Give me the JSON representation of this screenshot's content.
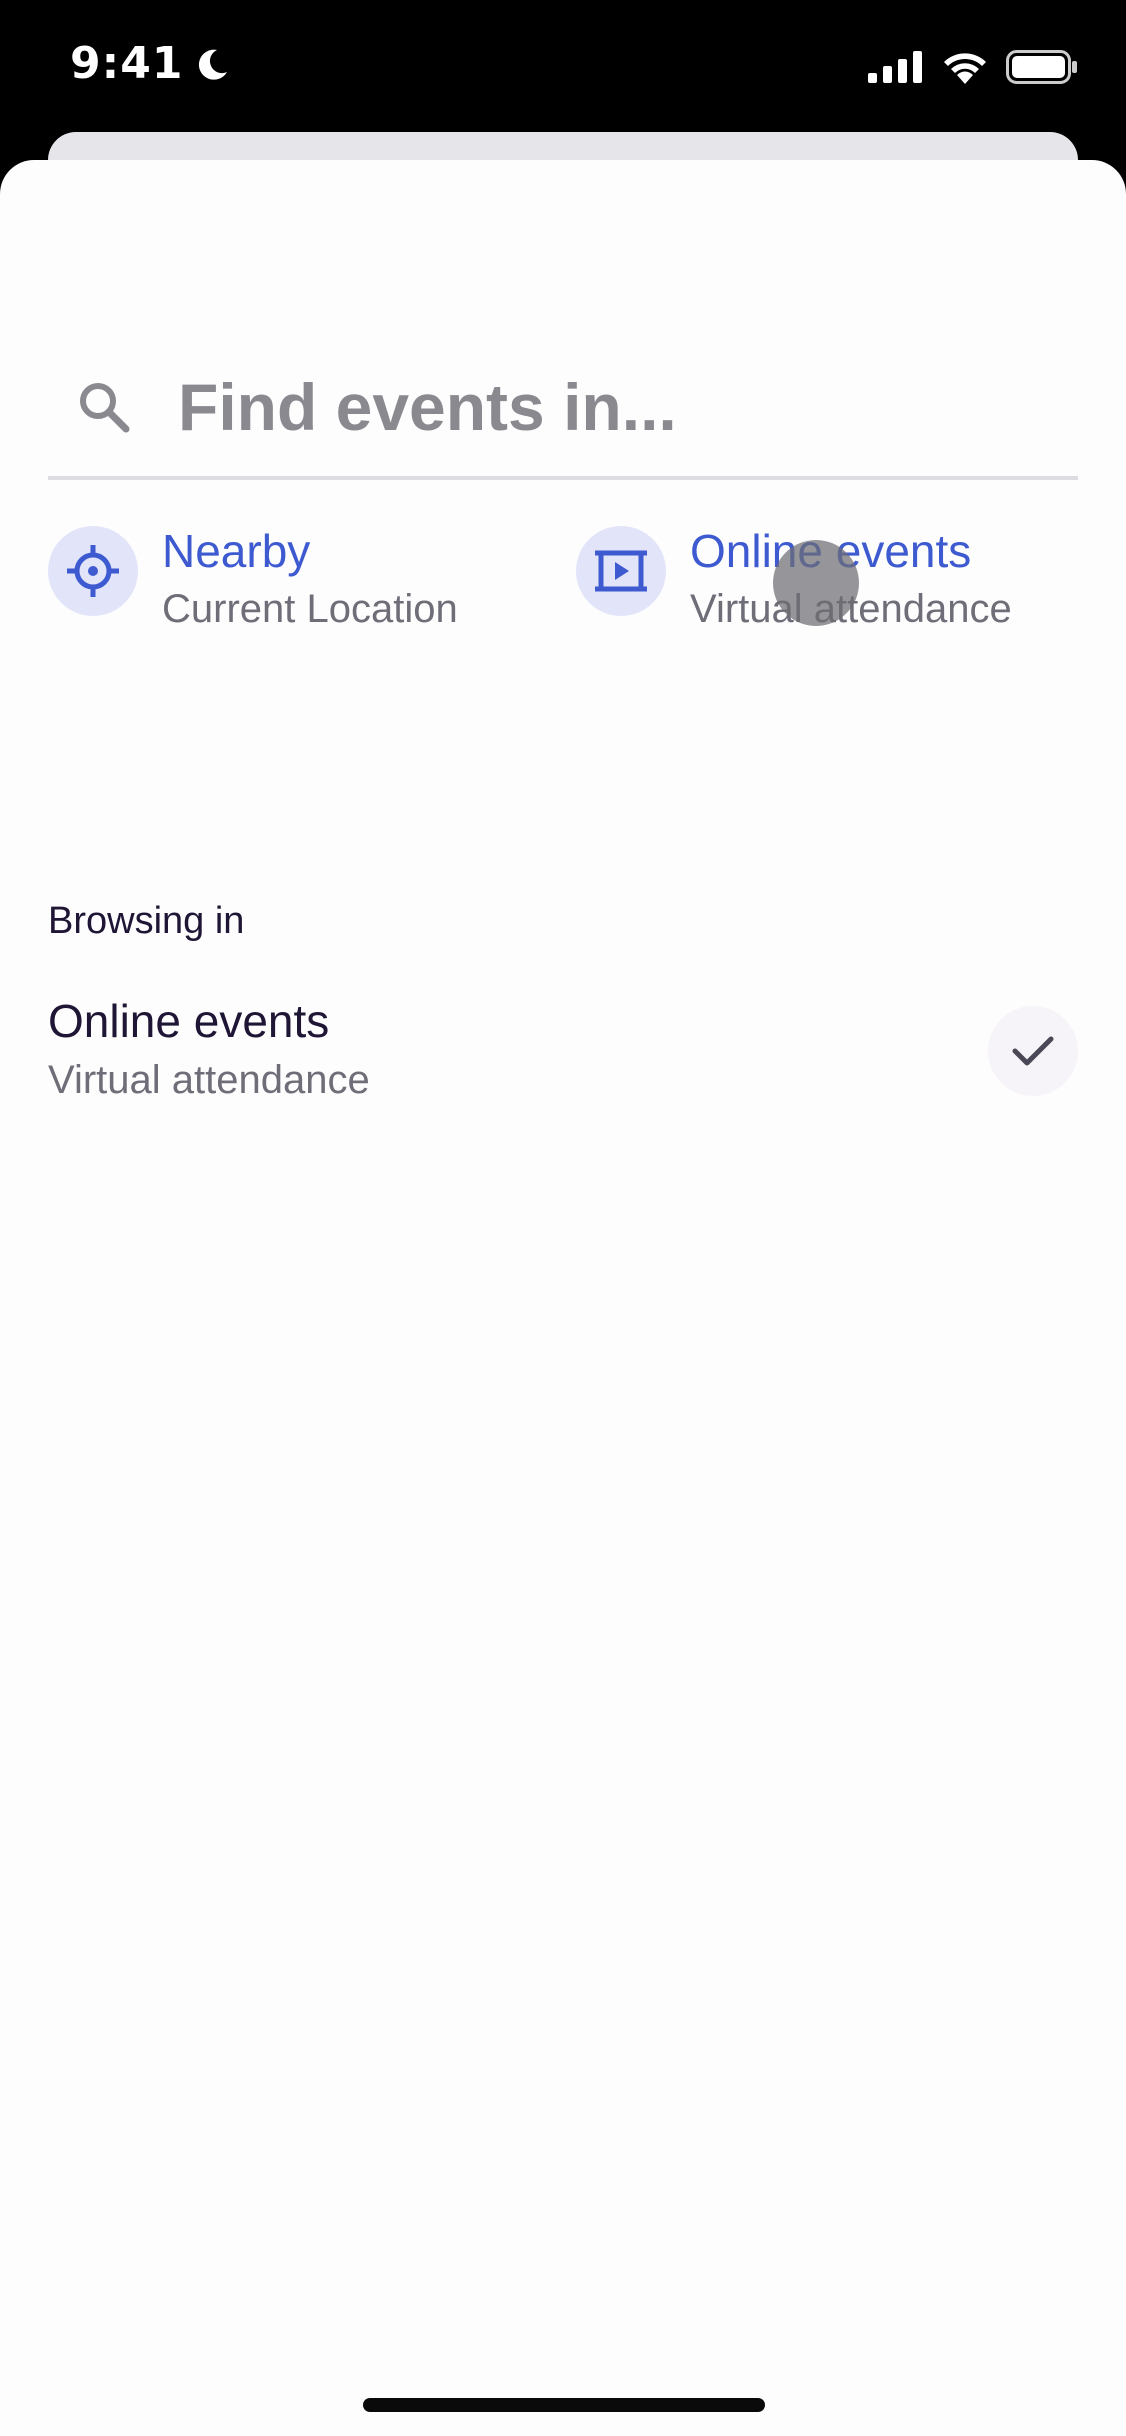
{
  "status_bar": {
    "time": "9:41",
    "icons": [
      "moon-icon",
      "cellular-signal-icon",
      "wifi-icon",
      "battery-icon"
    ]
  },
  "search": {
    "placeholder": "Find events in..."
  },
  "quick_options": [
    {
      "title": "Nearby",
      "subtitle": "Current Location",
      "icon": "location-target-icon"
    },
    {
      "title": "Online events",
      "subtitle": "Virtual attendance",
      "icon": "video-play-icon"
    }
  ],
  "browsing": {
    "label": "Browsing in",
    "selected_title": "Online events",
    "selected_subtitle": "Virtual attendance",
    "icon": "checkmark-icon"
  },
  "colors": {
    "accent": "#3d5ad0",
    "icon_bg": "#e2e4fa",
    "text_primary": "#1f1535",
    "text_secondary": "#6f6e78"
  }
}
